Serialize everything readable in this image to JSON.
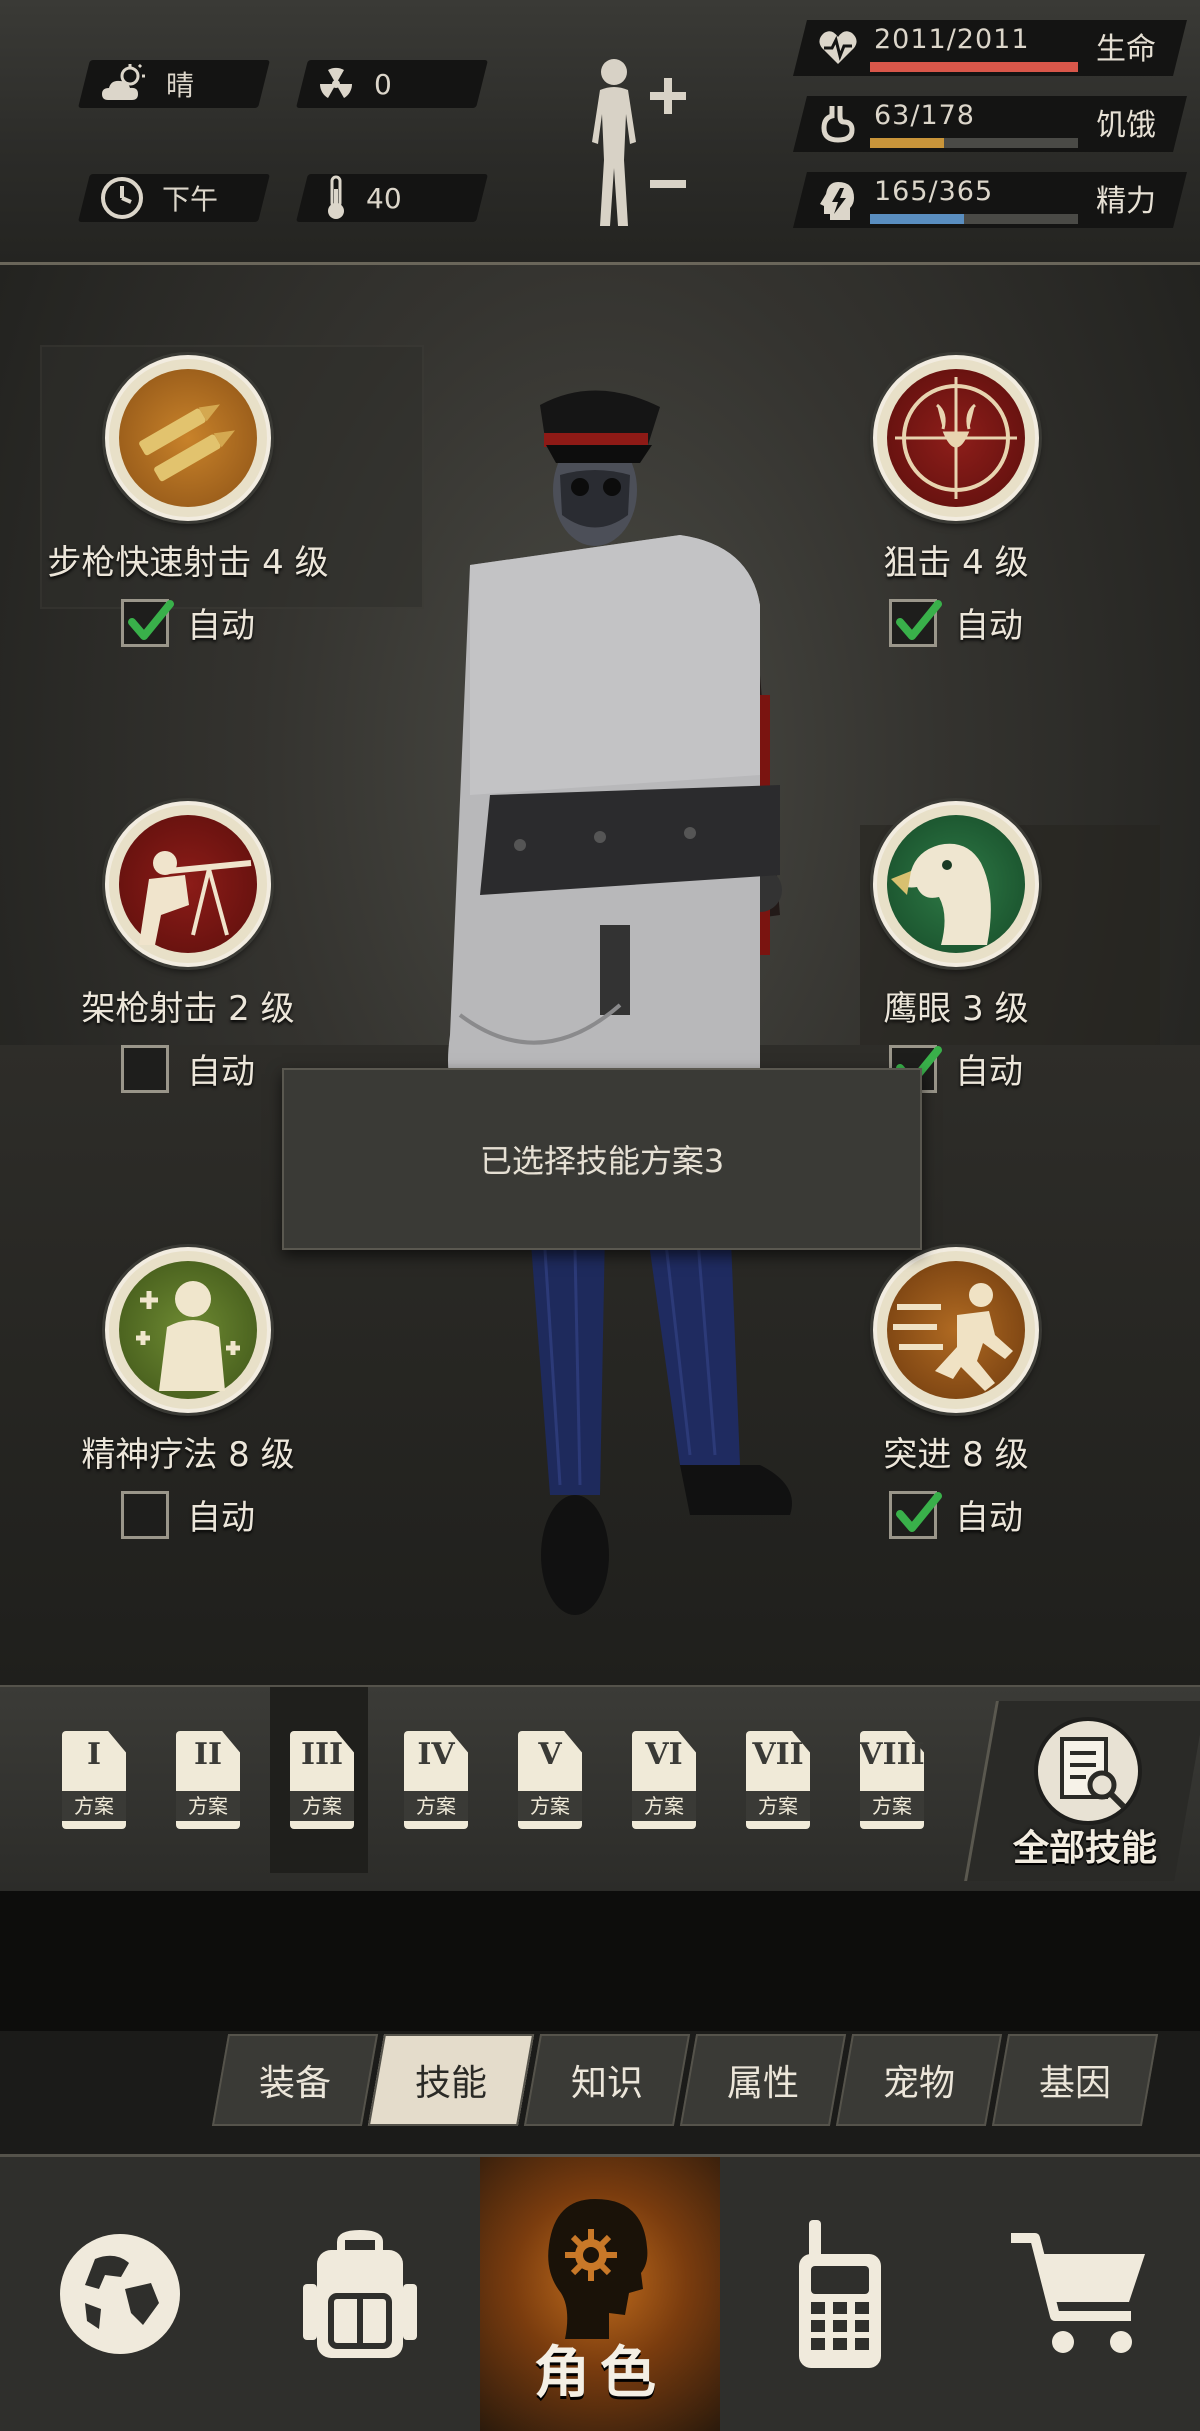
{
  "status": {
    "weather": "晴",
    "radiation": "0",
    "time_of_day": "下午",
    "temperature": "40",
    "health": {
      "value": "2011/2011",
      "label": "生命",
      "fraction": 1.0,
      "color": "#d9574a"
    },
    "hunger": {
      "value": "63/178",
      "label": "饥饿",
      "fraction": 0.354,
      "color": "#c9953a"
    },
    "energy": {
      "value": "165/365",
      "label": "精力",
      "fraction": 0.452,
      "color": "#5a8ec0"
    }
  },
  "skills": [
    {
      "name": "步枪快速射击 4 级",
      "auto_label": "自动",
      "auto": true,
      "icon": "rifle-bullets-icon"
    },
    {
      "name": "狙击 4 级",
      "auto_label": "自动",
      "auto": true,
      "icon": "sniper-crosshair-icon"
    },
    {
      "name": "架枪射击 2 级",
      "auto_label": "自动",
      "auto": false,
      "icon": "mounted-rifle-icon"
    },
    {
      "name": "鹰眼 3 级",
      "auto_label": "自动",
      "auto": true,
      "icon": "eagle-eye-icon"
    },
    {
      "name": "精神疗法 8 级",
      "auto_label": "自动",
      "auto": false,
      "icon": "mental-therapy-icon"
    },
    {
      "name": "突进 8 级",
      "auto_label": "自动",
      "auto": true,
      "icon": "dash-icon"
    }
  ],
  "toast": "已选择技能方案3",
  "plans": {
    "numerals": [
      "I",
      "II",
      "III",
      "IV",
      "V",
      "VI",
      "VII",
      "VIII"
    ],
    "label": "方案",
    "selected_index": 2,
    "all_skills_label": "全部技能"
  },
  "subtabs": [
    "装备",
    "技能",
    "知识",
    "属性",
    "宠物",
    "基因"
  ],
  "subtab_active": "技能",
  "nav": {
    "active_label": "角色",
    "items": [
      "globe-icon",
      "backpack-icon",
      "character-icon",
      "radio-icon",
      "cart-icon"
    ]
  }
}
